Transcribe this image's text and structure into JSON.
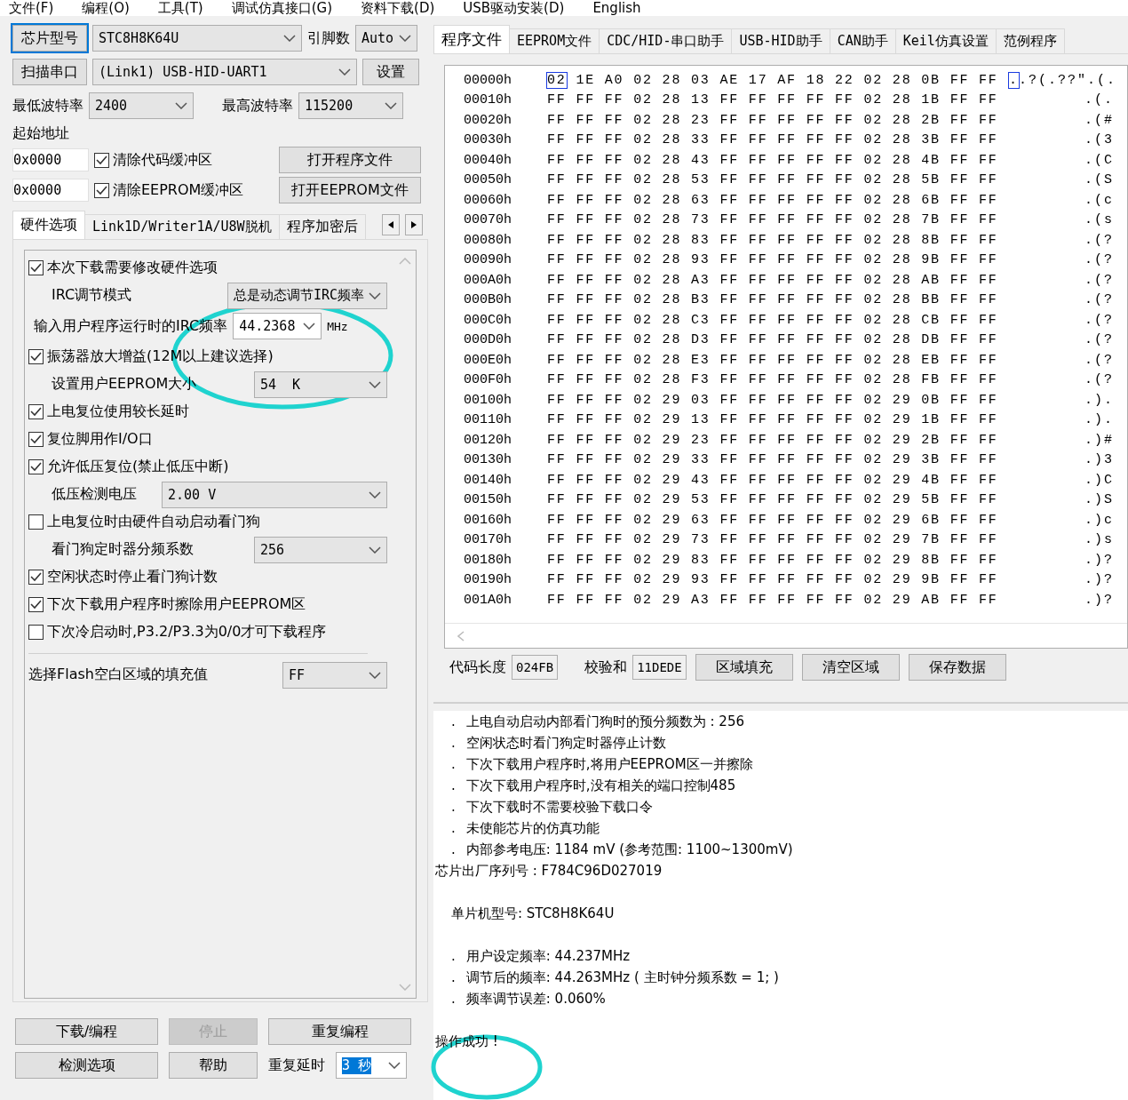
{
  "menu": [
    "文件(F)",
    "编程(O)",
    "工具(T)",
    "调试仿真接口(G)",
    "资料下载(D)",
    "USB驱动安装(D)",
    "English"
  ],
  "chip": {
    "button": "芯片型号",
    "value": "STC8H8K64U",
    "pins_label": "引脚数",
    "pins_value": "Auto"
  },
  "port": {
    "button": "扫描串口",
    "value": "(Link1) USB-HID-UART1",
    "settings": "设置"
  },
  "baud": {
    "min_label": "最低波特率",
    "min_value": "2400",
    "max_label": "最高波特率",
    "max_value": "115200"
  },
  "start_label": "起始地址",
  "address_rows": [
    {
      "address": "0x0000",
      "label": "清除代码缓冲区",
      "checked": true,
      "button": "打开程序文件"
    },
    {
      "address": "0x0000",
      "label": "清除EEPROM缓冲区",
      "checked": true,
      "button": "打开EEPROM文件"
    }
  ],
  "left_tabs": [
    {
      "label": "硬件选项",
      "selected": true
    },
    {
      "label": "Link1D/Writer1A/U8W脱机",
      "selected": false
    },
    {
      "label": "程序加密后",
      "selected": false
    }
  ],
  "options": [
    {
      "kind": "checkbox",
      "label": "本次下载需要修改硬件选项",
      "checked": true
    },
    {
      "kind": "select",
      "label": "IRC调节模式",
      "value": "总是动态调节IRC频率"
    },
    {
      "kind": "combo",
      "label": "输入用户程序运行时的IRC频率",
      "value": "44.2368",
      "unit": "MHz"
    },
    {
      "kind": "checkbox",
      "label": "振荡器放大增益(12M以上建议选择)",
      "checked": true
    },
    {
      "kind": "select",
      "label": "设置用户EEPROM大小",
      "value": "54  K"
    },
    {
      "kind": "checkbox",
      "label": "上电复位使用较长延时",
      "checked": true
    },
    {
      "kind": "checkbox",
      "label": "复位脚用作I/O口",
      "checked": true
    },
    {
      "kind": "checkbox",
      "label": "允许低压复位(禁止低压中断)",
      "checked": true
    },
    {
      "kind": "select",
      "label": "低压检测电压",
      "value": "2.00 V"
    },
    {
      "kind": "checkbox",
      "label": "上电复位时由硬件自动启动看门狗",
      "checked": false
    },
    {
      "kind": "select",
      "label": "看门狗定时器分频系数",
      "value": "256"
    },
    {
      "kind": "checkbox",
      "label": "空闲状态时停止看门狗计数",
      "checked": true
    },
    {
      "kind": "checkbox",
      "label": "下次下载用户程序时擦除用户EEPROM区",
      "checked": true
    },
    {
      "kind": "checkbox",
      "label": "下次冷启动时,P3.2/P3.3为0/0才可下载程序",
      "checked": false
    }
  ],
  "fill_value": {
    "label": "选择Flash空白区域的填充值",
    "value": "FF"
  },
  "actions": [
    {
      "label": "下载/编程",
      "disabled": false
    },
    {
      "label": "停止",
      "disabled": true
    },
    {
      "label": "重复编程",
      "disabled": false
    }
  ],
  "actions2": {
    "detect": "检测选项",
    "help": "帮助",
    "delay_label": "重复延时",
    "delay_value": "3 秒"
  },
  "right_tabs": [
    {
      "label": "程序文件",
      "selected": true
    },
    {
      "label": "EEPROM文件",
      "selected": false
    },
    {
      "label": "CDC/HID-串口助手",
      "selected": false
    },
    {
      "label": "USB-HID助手",
      "selected": false
    },
    {
      "label": "CAN助手",
      "selected": false
    },
    {
      "label": "Keil仿真设置",
      "selected": false
    },
    {
      "label": "范例程序",
      "selected": false
    }
  ],
  "hex_rows": [
    {
      "address": "00000h",
      "bytes": "02 1E A0 02 28 03 AE 17 AF 18 22 02 28 0B FF FF",
      "ascii": "..?(.??\".(.",
      "selected": true
    },
    {
      "address": "00010h",
      "bytes": "FF FF FF 02 28 13 FF FF FF FF FF 02 28 1B FF FF",
      "ascii": ".(.",
      "selected": false
    },
    {
      "address": "00020h",
      "bytes": "FF FF FF 02 28 23 FF FF FF FF FF 02 28 2B FF FF",
      "ascii": ".(#",
      "selected": false
    },
    {
      "address": "00030h",
      "bytes": "FF FF FF 02 28 33 FF FF FF FF FF 02 28 3B FF FF",
      "ascii": ".(3",
      "selected": false
    },
    {
      "address": "00040h",
      "bytes": "FF FF FF 02 28 43 FF FF FF FF FF 02 28 4B FF FF",
      "ascii": ".(C",
      "selected": false
    },
    {
      "address": "00050h",
      "bytes": "FF FF FF 02 28 53 FF FF FF FF FF 02 28 5B FF FF",
      "ascii": ".(S",
      "selected": false
    },
    {
      "address": "00060h",
      "bytes": "FF FF FF 02 28 63 FF FF FF FF FF 02 28 6B FF FF",
      "ascii": ".(c",
      "selected": false
    },
    {
      "address": "00070h",
      "bytes": "FF FF FF 02 28 73 FF FF FF FF FF 02 28 7B FF FF",
      "ascii": ".(s",
      "selected": false
    },
    {
      "address": "00080h",
      "bytes": "FF FF FF 02 28 83 FF FF FF FF FF 02 28 8B FF FF",
      "ascii": ".(?",
      "selected": false
    },
    {
      "address": "00090h",
      "bytes": "FF FF FF 02 28 93 FF FF FF FF FF 02 28 9B FF FF",
      "ascii": ".(?",
      "selected": false
    },
    {
      "address": "000A0h",
      "bytes": "FF FF FF 02 28 A3 FF FF FF FF FF 02 28 AB FF FF",
      "ascii": ".(?",
      "selected": false
    },
    {
      "address": "000B0h",
      "bytes": "FF FF FF 02 28 B3 FF FF FF FF FF 02 28 BB FF FF",
      "ascii": ".(?",
      "selected": false
    },
    {
      "address": "000C0h",
      "bytes": "FF FF FF 02 28 C3 FF FF FF FF FF 02 28 CB FF FF",
      "ascii": ".(?",
      "selected": false
    },
    {
      "address": "000D0h",
      "bytes": "FF FF FF 02 28 D3 FF FF FF FF FF 02 28 DB FF FF",
      "ascii": ".(?",
      "selected": false
    },
    {
      "address": "000E0h",
      "bytes": "FF FF FF 02 28 E3 FF FF FF FF FF 02 28 EB FF FF",
      "ascii": ".(?",
      "selected": false
    },
    {
      "address": "000F0h",
      "bytes": "FF FF FF 02 28 F3 FF FF FF FF FF 02 28 FB FF FF",
      "ascii": ".(?",
      "selected": false
    },
    {
      "address": "00100h",
      "bytes": "FF FF FF 02 29 03 FF FF FF FF FF 02 29 0B FF FF",
      "ascii": ".).",
      "selected": false
    },
    {
      "address": "00110h",
      "bytes": "FF FF FF 02 29 13 FF FF FF FF FF 02 29 1B FF FF",
      "ascii": ".).",
      "selected": false
    },
    {
      "address": "00120h",
      "bytes": "FF FF FF 02 29 23 FF FF FF FF FF 02 29 2B FF FF",
      "ascii": ".)#",
      "selected": false
    },
    {
      "address": "00130h",
      "bytes": "FF FF FF 02 29 33 FF FF FF FF FF 02 29 3B FF FF",
      "ascii": ".)3",
      "selected": false
    },
    {
      "address": "00140h",
      "bytes": "FF FF FF 02 29 43 FF FF FF FF FF 02 29 4B FF FF",
      "ascii": ".)C",
      "selected": false
    },
    {
      "address": "00150h",
      "bytes": "FF FF FF 02 29 53 FF FF FF FF FF 02 29 5B FF FF",
      "ascii": ".)S",
      "selected": false
    },
    {
      "address": "00160h",
      "bytes": "FF FF FF 02 29 63 FF FF FF FF FF 02 29 6B FF FF",
      "ascii": ".)c",
      "selected": false
    },
    {
      "address": "00170h",
      "bytes": "FF FF FF 02 29 73 FF FF FF FF FF 02 29 7B FF FF",
      "ascii": ".)s",
      "selected": false
    },
    {
      "address": "00180h",
      "bytes": "FF FF FF 02 29 83 FF FF FF FF FF 02 29 8B FF FF",
      "ascii": ".)?",
      "selected": false
    },
    {
      "address": "00190h",
      "bytes": "FF FF FF 02 29 93 FF FF FF FF FF 02 29 9B FF FF",
      "ascii": ".)?",
      "selected": false
    },
    {
      "address": "001A0h",
      "bytes": "FF FF FF 02 29 A3 FF FF FF FF FF 02 29 AB FF FF",
      "ascii": ".)?",
      "selected": false
    }
  ],
  "hex_footer": {
    "length_label": "代码长度",
    "length_value": "024FB",
    "checksum_label": "校验和",
    "checksum_value": "11DEDE",
    "buttons": [
      "区域填充",
      "清空区域",
      "保存数据"
    ]
  },
  "log": [
    {
      "kind": "item",
      "mark": ".",
      "text": "上电自动启动内部看门狗时的预分频数为 : 256"
    },
    {
      "kind": "item",
      "mark": ".",
      "text": "空闲状态时看门狗定时器停止计数"
    },
    {
      "kind": "item",
      "mark": ".",
      "text": "下次下载用户程序时,将用户EEPROM区一并擦除"
    },
    {
      "kind": "item",
      "mark": ".",
      "text": "下次下载用户程序时,没有相关的端口控制485"
    },
    {
      "kind": "item",
      "mark": ".",
      "text": "下次下载时不需要校验下载口令"
    },
    {
      "kind": "item",
      "mark": ".",
      "text": "未使能芯片的仿真功能"
    },
    {
      "kind": "item",
      "mark": ".",
      "text": "内部参考电压: 1184 mV (参考范围: 1100~1300mV)"
    },
    {
      "kind": "plain",
      "text": "芯片出厂序列号 : F784C96D027019"
    },
    {
      "kind": "gap"
    },
    {
      "kind": "heading",
      "text": "单片机型号: STC8H8K64U"
    },
    {
      "kind": "gap"
    },
    {
      "kind": "item",
      "mark": ".",
      "text": "用户设定频率: 44.237MHz"
    },
    {
      "kind": "item",
      "mark": ".",
      "text": "调节后的频率: 44.263MHz ( 主时钟分频系数 = 1; )"
    },
    {
      "kind": "item",
      "mark": ".",
      "text": "频率调节误差: 0.060%"
    },
    {
      "kind": "gap"
    },
    {
      "kind": "plain",
      "text": "操作成功 !"
    }
  ]
}
